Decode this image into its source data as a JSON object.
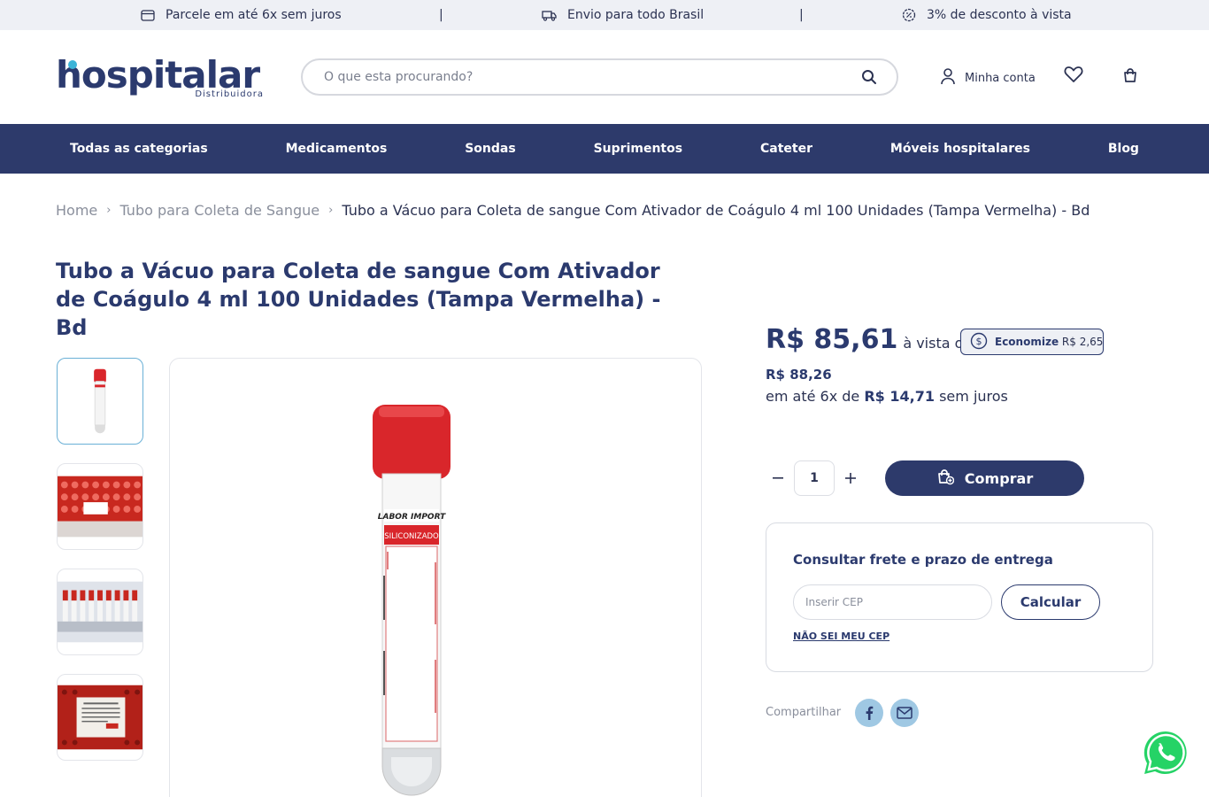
{
  "topbar": {
    "items": [
      {
        "icon": "credit-card-icon",
        "label": "Parcele em até 6x sem juros"
      },
      {
        "icon": "truck-icon",
        "label": "Envio para todo Brasil"
      },
      {
        "icon": "discount-badge-icon",
        "label": "3% de desconto à vista"
      }
    ],
    "separator": "|"
  },
  "header": {
    "logo_text": "hospitalar",
    "logo_sub": "Distribuidora",
    "search_placeholder": "O que esta procurando?",
    "account_label": "Minha conta"
  },
  "nav": {
    "items": [
      "Todas as categorias",
      "Medicamentos",
      "Sondas",
      "Suprimentos",
      "Cateter",
      "Móveis hospitalares",
      "Blog"
    ]
  },
  "breadcrumb": {
    "items": [
      "Home",
      "Tubo para Coleta de Sangue"
    ],
    "current": "Tubo a Vácuo para Coleta de sangue Com Ativador de Coágulo 4 ml 100 Unidades (Tampa Vermelha) - Bd"
  },
  "product": {
    "title": "Tubo a Vácuo para Coleta de sangue Com Ativador de Coágulo 4 ml 100 Unidades (Tampa Vermelha) - Bd",
    "image_labels": {
      "brand": "LABOR IMPORT",
      "band": "SILICONIZADO"
    },
    "price_cash": "R$ 85,61",
    "price_cash_suffix": "à vista ou",
    "economize_label": "Economize",
    "economize_value": "R$ 2,65",
    "price_full": "R$ 88,26",
    "installments_prefix": "em até 6x de",
    "installments_value": "R$ 14,71",
    "installments_suffix": "sem juros",
    "quantity": "1",
    "buy_label": "Comprar"
  },
  "shipping": {
    "title": "Consultar frete e prazo de entrega",
    "cep_placeholder": "Inserir CEP",
    "calc_label": "Calcular",
    "nao_sei_label": "NÃO SEI MEU CEP"
  },
  "share": {
    "label": "Compartilhar",
    "buttons": [
      "facebook-icon",
      "email-icon"
    ]
  },
  "colors": {
    "brand_navy": "#2d3a6b",
    "accent_blue": "#3cb4d8",
    "tube_red": "#d9262b"
  }
}
